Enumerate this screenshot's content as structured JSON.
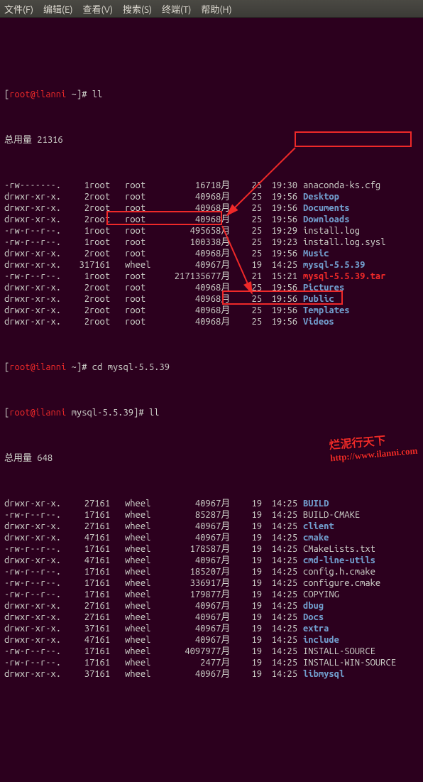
{
  "menu": {
    "file": "文件(F)",
    "edit": "编辑(E)",
    "view": "查看(V)",
    "search": "搜索(S)",
    "terminal": "终端(T)",
    "help": "帮助(H)"
  },
  "prompt1": {
    "user": "root",
    "host": "ilanni",
    "path": "~",
    "symbol": "#"
  },
  "cmd1": "ll",
  "total1_label": "总用量",
  "total1_value": "21316",
  "rows1": [
    {
      "perm": "-rw-------.",
      "links": "1",
      "owner": "root",
      "group": "root",
      "size": "1671",
      "month": "8月",
      "day": "25",
      "time": "19:30",
      "name": "anaconda-ks.cfg",
      "cls": "white"
    },
    {
      "perm": "drwxr-xr-x.",
      "links": "2",
      "owner": "root",
      "group": "root",
      "size": "4096",
      "month": "8月",
      "day": "25",
      "time": "19:56",
      "name": "Desktop",
      "cls": "dir"
    },
    {
      "perm": "drwxr-xr-x.",
      "links": "2",
      "owner": "root",
      "group": "root",
      "size": "4096",
      "month": "8月",
      "day": "25",
      "time": "19:56",
      "name": "Documents",
      "cls": "dir"
    },
    {
      "perm": "drwxr-xr-x.",
      "links": "2",
      "owner": "root",
      "group": "root",
      "size": "4096",
      "month": "8月",
      "day": "25",
      "time": "19:56",
      "name": "Downloads",
      "cls": "dir"
    },
    {
      "perm": "-rw-r--r--.",
      "links": "1",
      "owner": "root",
      "group": "root",
      "size": "49565",
      "month": "8月",
      "day": "25",
      "time": "19:29",
      "name": "install.log",
      "cls": "white"
    },
    {
      "perm": "-rw-r--r--.",
      "links": "1",
      "owner": "root",
      "group": "root",
      "size": "10033",
      "month": "8月",
      "day": "25",
      "time": "19:23",
      "name": "install.log.sysl",
      "cls": "white"
    },
    {
      "perm": "drwxr-xr-x.",
      "links": "2",
      "owner": "root",
      "group": "root",
      "size": "4096",
      "month": "8月",
      "day": "25",
      "time": "19:56",
      "name": "Music",
      "cls": "dir"
    },
    {
      "perm": "drwxr-xr-x.",
      "links": "31",
      "owner": "7161",
      "group": "wheel",
      "size": "4096",
      "month": "7月",
      "day": "19",
      "time": "14:25",
      "name": "mysql-5.5.39",
      "cls": "dir"
    },
    {
      "perm": "-rw-r--r--.",
      "links": "1",
      "owner": "root",
      "group": "root",
      "size": "21713567",
      "month": "7月",
      "day": "21",
      "time": "15:21",
      "name": "mysql-5.5.39.tar",
      "cls": "red"
    },
    {
      "perm": "drwxr-xr-x.",
      "links": "2",
      "owner": "root",
      "group": "root",
      "size": "4096",
      "month": "8月",
      "day": "25",
      "time": "19:56",
      "name": "Pictures",
      "cls": "dir"
    },
    {
      "perm": "drwxr-xr-x.",
      "links": "2",
      "owner": "root",
      "group": "root",
      "size": "4096",
      "month": "8月",
      "day": "25",
      "time": "19:56",
      "name": "Public",
      "cls": "dir"
    },
    {
      "perm": "drwxr-xr-x.",
      "links": "2",
      "owner": "root",
      "group": "root",
      "size": "4096",
      "month": "8月",
      "day": "25",
      "time": "19:56",
      "name": "Templates",
      "cls": "dir"
    },
    {
      "perm": "drwxr-xr-x.",
      "links": "2",
      "owner": "root",
      "group": "root",
      "size": "4096",
      "month": "8月",
      "day": "25",
      "time": "19:56",
      "name": "Videos",
      "cls": "dir"
    }
  ],
  "cmd2": "cd mysql-5.5.39",
  "prompt2": {
    "user": "root",
    "host": "ilanni",
    "path": "mysql-5.5.39",
    "symbol": "#"
  },
  "cmd3": "ll",
  "total2_label": "总用量",
  "total2_value": "648",
  "rows2": [
    {
      "perm": "drwxr-xr-x.",
      "links": "2",
      "owner": "7161",
      "group": "wheel",
      "size": "4096",
      "month": "7月",
      "day": "19",
      "time": "14:25",
      "name": "BUILD",
      "cls": "dir"
    },
    {
      "perm": "-rw-r--r--.",
      "links": "1",
      "owner": "7161",
      "group": "wheel",
      "size": "8528",
      "month": "7月",
      "day": "19",
      "time": "14:25",
      "name": "BUILD-CMAKE",
      "cls": "white"
    },
    {
      "perm": "drwxr-xr-x.",
      "links": "2",
      "owner": "7161",
      "group": "wheel",
      "size": "4096",
      "month": "7月",
      "day": "19",
      "time": "14:25",
      "name": "client",
      "cls": "dir"
    },
    {
      "perm": "drwxr-xr-x.",
      "links": "4",
      "owner": "7161",
      "group": "wheel",
      "size": "4096",
      "month": "7月",
      "day": "19",
      "time": "14:25",
      "name": "cmake",
      "cls": "dir"
    },
    {
      "perm": "-rw-r--r--.",
      "links": "1",
      "owner": "7161",
      "group": "wheel",
      "size": "17858",
      "month": "7月",
      "day": "19",
      "time": "14:25",
      "name": "CMakeLists.txt",
      "cls": "white"
    },
    {
      "perm": "drwxr-xr-x.",
      "links": "4",
      "owner": "7161",
      "group": "wheel",
      "size": "4096",
      "month": "7月",
      "day": "19",
      "time": "14:25",
      "name": "cmd-line-utils",
      "cls": "dir"
    },
    {
      "perm": "-rw-r--r--.",
      "links": "1",
      "owner": "7161",
      "group": "wheel",
      "size": "18520",
      "month": "7月",
      "day": "19",
      "time": "14:25",
      "name": "config.h.cmake",
      "cls": "white"
    },
    {
      "perm": "-rw-r--r--.",
      "links": "1",
      "owner": "7161",
      "group": "wheel",
      "size": "33691",
      "month": "7月",
      "day": "19",
      "time": "14:25",
      "name": "configure.cmake",
      "cls": "white"
    },
    {
      "perm": "-rw-r--r--.",
      "links": "1",
      "owner": "7161",
      "group": "wheel",
      "size": "17987",
      "month": "7月",
      "day": "19",
      "time": "14:25",
      "name": "COPYING",
      "cls": "white"
    },
    {
      "perm": "drwxr-xr-x.",
      "links": "2",
      "owner": "7161",
      "group": "wheel",
      "size": "4096",
      "month": "7月",
      "day": "19",
      "time": "14:25",
      "name": "dbug",
      "cls": "dir"
    },
    {
      "perm": "drwxr-xr-x.",
      "links": "2",
      "owner": "7161",
      "group": "wheel",
      "size": "4096",
      "month": "7月",
      "day": "19",
      "time": "14:25",
      "name": "Docs",
      "cls": "dir"
    },
    {
      "perm": "drwxr-xr-x.",
      "links": "3",
      "owner": "7161",
      "group": "wheel",
      "size": "4096",
      "month": "7月",
      "day": "19",
      "time": "14:25",
      "name": "extra",
      "cls": "dir"
    },
    {
      "perm": "drwxr-xr-x.",
      "links": "4",
      "owner": "7161",
      "group": "wheel",
      "size": "4096",
      "month": "7月",
      "day": "19",
      "time": "14:25",
      "name": "include",
      "cls": "dir"
    },
    {
      "perm": "-rw-r--r--.",
      "links": "1",
      "owner": "7161",
      "group": "wheel",
      "size": "409797",
      "month": "7月",
      "day": "19",
      "time": "14:25",
      "name": "INSTALL-SOURCE",
      "cls": "white"
    },
    {
      "perm": "-rw-r--r--.",
      "links": "1",
      "owner": "7161",
      "group": "wheel",
      "size": "247",
      "month": "7月",
      "day": "19",
      "time": "14:25",
      "name": "INSTALL-WIN-SOURCE",
      "cls": "white"
    },
    {
      "perm": "drwxr-xr-x.",
      "links": "3",
      "owner": "7161",
      "group": "wheel",
      "size": "4096",
      "month": "7月",
      "day": "19",
      "time": "14:25",
      "name": "libmysql",
      "cls": "dir"
    }
  ],
  "watermark": {
    "line1": "烂泥行天下",
    "line2": "http://www.ilanni.com"
  }
}
